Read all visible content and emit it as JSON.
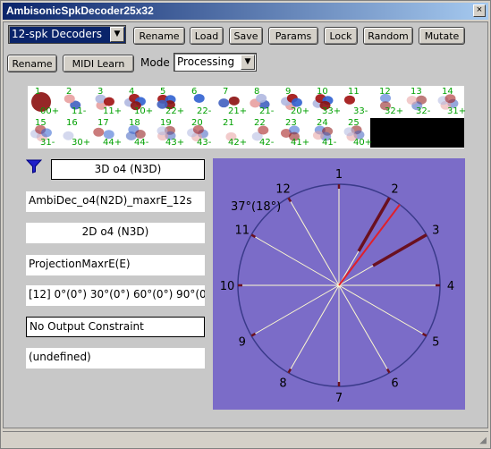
{
  "window": {
    "title": "AmbisonicSpkDecoder25x32",
    "close_glyph": "×"
  },
  "toolbar1": {
    "preset_select": "12-spk Decoders",
    "buttons": [
      "Rename",
      "Load",
      "Save",
      "Params",
      "Lock",
      "Random",
      "Mutate"
    ]
  },
  "toolbar2": {
    "rename": "Rename",
    "midi_learn": "MIDI Learn",
    "mode_label": "Mode",
    "mode_value": "Processing"
  },
  "thumbnails": [
    {
      "num": "1",
      "label": "00+"
    },
    {
      "num": "2",
      "label": "11-"
    },
    {
      "num": "3",
      "label": "11+"
    },
    {
      "num": "4",
      "label": "10+"
    },
    {
      "num": "5",
      "label": "22+"
    },
    {
      "num": "6",
      "label": "22-"
    },
    {
      "num": "7",
      "label": "21+"
    },
    {
      "num": "8",
      "label": "21-"
    },
    {
      "num": "9",
      "label": "20+"
    },
    {
      "num": "10",
      "label": "33+"
    },
    {
      "num": "11",
      "label": "33-"
    },
    {
      "num": "12",
      "label": "32+"
    },
    {
      "num": "13",
      "label": "32-"
    },
    {
      "num": "14",
      "label": "31+"
    },
    {
      "num": "15",
      "label": "31-"
    },
    {
      "num": "16",
      "label": "30+"
    },
    {
      "num": "17",
      "label": "44+"
    },
    {
      "num": "18",
      "label": "44-"
    },
    {
      "num": "19",
      "label": "43+"
    },
    {
      "num": "20",
      "label": "43-"
    },
    {
      "num": "21",
      "label": "42+"
    },
    {
      "num": "22",
      "label": "42-"
    },
    {
      "num": "23",
      "label": "41+"
    },
    {
      "num": "24",
      "label": "41-"
    },
    {
      "num": "25",
      "label": "40+"
    }
  ],
  "fields": {
    "format_3d": "3D o4 (N3D)",
    "decoder_name": "AmbiDec_o4(N2D)_maxrE_12s",
    "format_2d": "2D o4 (N3D)",
    "method": "ProjectionMaxrE(E)",
    "speakers": "[12] 0°(0°) 30°(0°) 60°(0°) 90°(0°",
    "constraint": "No Output Constraint",
    "undefined": "(undefined)"
  },
  "plot": {
    "speaker_labels": [
      "1",
      "2",
      "3",
      "4",
      "5",
      "6",
      "7",
      "8",
      "9",
      "10",
      "11",
      "12"
    ],
    "angle_readout": "37°(18°)",
    "colors": {
      "background": "#7b6cc8",
      "spokes": "#fffbd0",
      "circle": "#3a3a8a",
      "highlight": "#6a1020",
      "accent": "#e0202a"
    }
  },
  "icons": {
    "filter": "filter-icon",
    "dropdown": "chevron-down-icon"
  }
}
